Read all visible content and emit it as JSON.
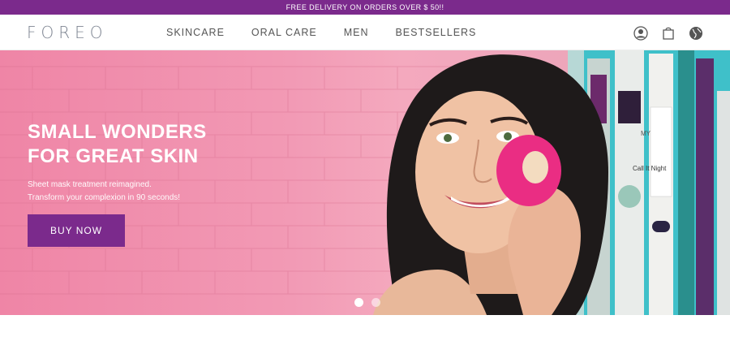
{
  "promo": {
    "text": "FREE DELIVERY ON ORDERS OVER $ 50!!"
  },
  "header": {
    "logo": "FOREO",
    "nav": [
      {
        "label": "SKINCARE"
      },
      {
        "label": "ORAL CARE"
      },
      {
        "label": "MEN"
      },
      {
        "label": "BESTSELLERS"
      }
    ],
    "icons": [
      "account-icon",
      "shopping-bag-icon",
      "globe-icon"
    ]
  },
  "hero": {
    "title": "SMALL WONDERS\nFOR GREAT SKIN",
    "subtitle": "Sheet mask treatment reimagined.\nTransform your complexion in 90 seconds!",
    "cta_label": "BUY NOW",
    "slide_count": 2,
    "active_slide": 1,
    "poster_text": [
      "MY",
      "Call It Night"
    ]
  },
  "colors": {
    "brand_purple": "#7b2a8c",
    "hero_pink": "#f29ab5",
    "device_pink": "#ea2d83"
  }
}
